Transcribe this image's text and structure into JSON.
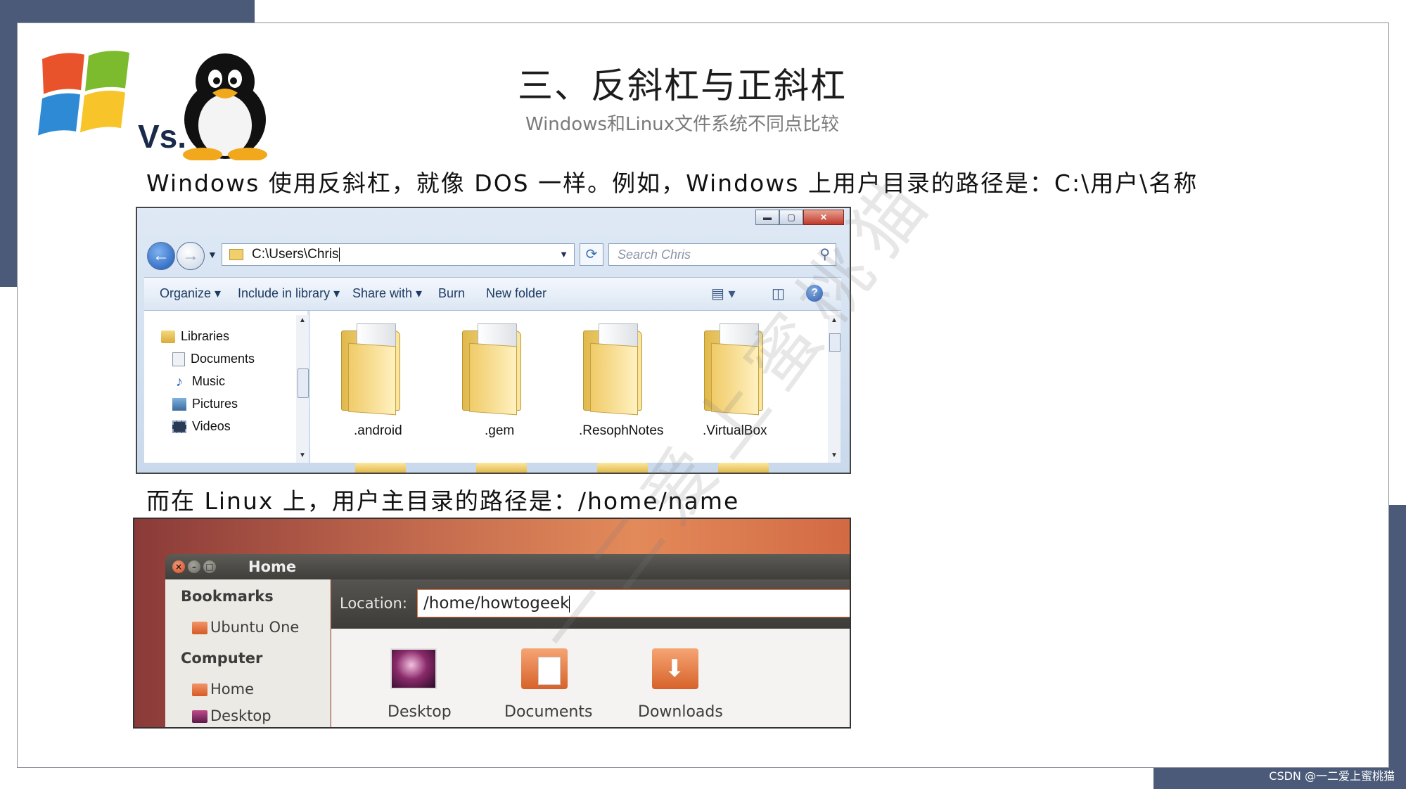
{
  "slide": {
    "title": "三、反斜杠与正斜杠",
    "subtitle": "Windows和Linux文件系统不同点比较",
    "logo_text": "Vs.",
    "para1": "Windows 使用反斜杠，就像 DOS 一样。例如，Windows 上用户目录的路径是：C:\\用户\\名称",
    "para2": "而在 Linux 上，用户主目录的路径是：/home/name",
    "watermark": "一二爱上蜜桃猫",
    "footer": "CSDN @一二爱上蜜桃猫"
  },
  "windows_explorer": {
    "address": "C:\\Users\\Chris",
    "search_placeholder": "Search Chris",
    "toolbar": [
      "Organize",
      "Include in library",
      "Share with",
      "Burn",
      "New folder"
    ],
    "nav": [
      "Libraries",
      "Documents",
      "Music",
      "Pictures",
      "Videos"
    ],
    "folders": [
      ".android",
      ".gem",
      ".ResophNotes",
      ".VirtualBox"
    ]
  },
  "ubuntu_nautilus": {
    "title": "Home",
    "sidebar": {
      "section1": "Bookmarks",
      "bookmark1": "Ubuntu One",
      "section2": "Computer",
      "item1": "Home",
      "item2": "Desktop"
    },
    "location_label": "Location:",
    "location_value": "/home/howtogeek",
    "icons": [
      "Desktop",
      "Documents",
      "Downloads"
    ]
  },
  "colors": {
    "deco": "#4a5a78",
    "ubuntu_orange": "#e07a4a",
    "win_folder": "#f1cf6c"
  }
}
